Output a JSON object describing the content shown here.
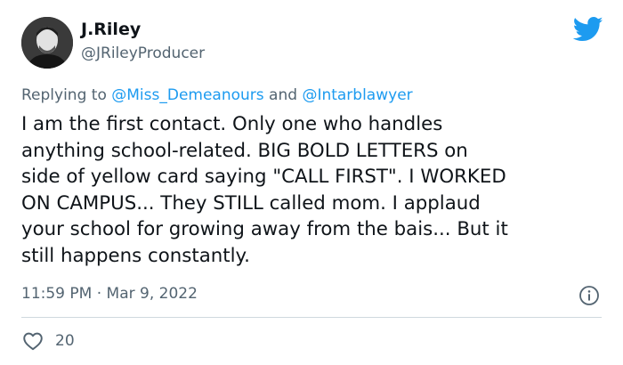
{
  "author": {
    "display_name": "J.Riley",
    "handle": "@JRileyProducer"
  },
  "reply": {
    "prefix": "Replying to",
    "mention_1": "@Miss_Demeanours",
    "conjunction": "and",
    "mention_2": "@Intarblawyer"
  },
  "tweet": {
    "lines": [
      "I am the first contact. Only one who handles",
      "anything school-related. BIG BOLD LETTERS on",
      "side of yellow card saying \"CALL FIRST\". I WORKED",
      "ON CAMPUS... They STILL called mom. I applaud",
      "your school for growing away from the bais... But it",
      "still happens constantly."
    ]
  },
  "meta": {
    "timestamp": "11:59 PM · Mar 9, 2022",
    "likes": "20"
  },
  "icons": {
    "brand": "twitter-bird-icon",
    "info": "info-icon",
    "like": "heart-icon"
  },
  "colors": {
    "brand": "#1d9bf0",
    "text": "#0f1419",
    "secondary": "#536471",
    "divider": "#cfd9de"
  }
}
